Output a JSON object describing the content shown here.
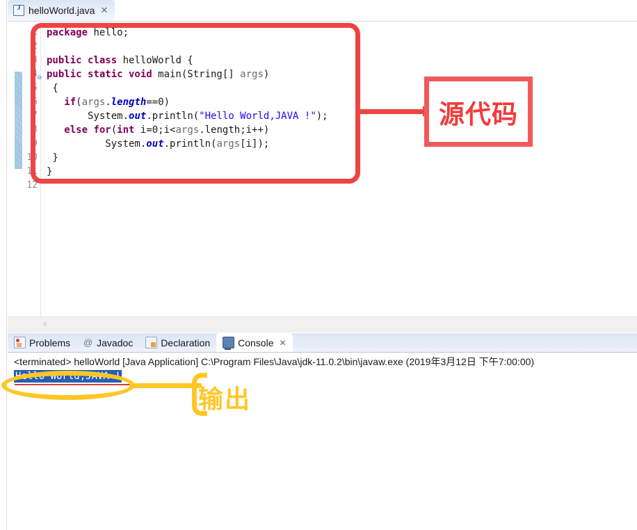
{
  "editor": {
    "tab": {
      "icon": "java-file-icon",
      "label": "helloWorld.java",
      "close": "✕"
    },
    "line_numbers": [
      "1",
      "2",
      "3",
      "4",
      "5",
      "6",
      "7",
      "8",
      "9",
      "10",
      "11",
      "12"
    ],
    "fold_marker": "⊖",
    "code_lines": [
      {
        "n": 1,
        "segments": [
          {
            "text": "package",
            "style": "kw"
          },
          {
            "text": " hello;",
            "style": "plain"
          }
        ]
      },
      {
        "n": 2,
        "segments": []
      },
      {
        "n": 3,
        "segments": [
          {
            "text": "public class",
            "style": "kw"
          },
          {
            "text": " helloWorld {",
            "style": "plain"
          }
        ]
      },
      {
        "n": 4,
        "segments": [
          {
            "text": "public static void",
            "style": "kw"
          },
          {
            "text": " main(String[] ",
            "style": "plain"
          },
          {
            "text": "args",
            "style": "param"
          },
          {
            "text": ")",
            "style": "plain"
          }
        ]
      },
      {
        "n": 5,
        "segments": [
          {
            "text": " {",
            "style": "plain"
          }
        ]
      },
      {
        "n": 6,
        "segments": [
          {
            "text": "   ",
            "style": "plain"
          },
          {
            "text": "if",
            "style": "kw"
          },
          {
            "text": "(",
            "style": "plain"
          },
          {
            "text": "args",
            "style": "param"
          },
          {
            "text": ".",
            "style": "plain"
          },
          {
            "text": "length",
            "style": "field"
          },
          {
            "text": "==0)",
            "style": "plain"
          }
        ]
      },
      {
        "n": 7,
        "segments": [
          {
            "text": "       System.",
            "style": "plain"
          },
          {
            "text": "out",
            "style": "field"
          },
          {
            "text": ".println(",
            "style": "plain"
          },
          {
            "text": "\"Hello World,JAVA !\"",
            "style": "str"
          },
          {
            "text": ");",
            "style": "plain"
          }
        ]
      },
      {
        "n": 8,
        "segments": [
          {
            "text": "   ",
            "style": "plain"
          },
          {
            "text": "else for",
            "style": "kw"
          },
          {
            "text": "(",
            "style": "plain"
          },
          {
            "text": "int",
            "style": "kw"
          },
          {
            "text": " i=0;i<",
            "style": "plain"
          },
          {
            "text": "args",
            "style": "param"
          },
          {
            "text": ".length;i++)",
            "style": "plain"
          }
        ]
      },
      {
        "n": 9,
        "segments": [
          {
            "text": "          System.",
            "style": "plain"
          },
          {
            "text": "out",
            "style": "field"
          },
          {
            "text": ".println(",
            "style": "plain"
          },
          {
            "text": "args",
            "style": "param"
          },
          {
            "text": "[i]);",
            "style": "plain"
          }
        ]
      },
      {
        "n": 10,
        "segments": [
          {
            "text": " }",
            "style": "plain"
          }
        ]
      },
      {
        "n": 11,
        "segments": [
          {
            "text": "}",
            "style": "plain"
          }
        ]
      },
      {
        "n": 12,
        "segments": []
      }
    ],
    "scrollbar": {
      "left_arrow": "‹"
    }
  },
  "bottom_view": {
    "tabs": [
      {
        "id": "problems",
        "label": "Problems",
        "icon": "problems-icon",
        "active": false,
        "closable": false
      },
      {
        "id": "javadoc",
        "label": "Javadoc",
        "icon": "javadoc-icon",
        "active": false,
        "closable": false
      },
      {
        "id": "declaration",
        "label": "Declaration",
        "icon": "declaration-icon",
        "active": false,
        "closable": false
      },
      {
        "id": "console",
        "label": "Console",
        "icon": "console-icon",
        "active": true,
        "closable": true
      }
    ],
    "close_glyph": "✕",
    "console": {
      "status_line": "<terminated> helloWorld [Java Application] C:\\Program Files\\Java\\jdk-11.0.2\\bin\\javaw.exe (2019年3月12日 下午7:00:00)",
      "output_line": "Hello World,JAVA !",
      "output_selected": true
    }
  },
  "annotations": {
    "source_code": {
      "label": "源代码",
      "color": "#f23b3b",
      "box_color": "#ef4444"
    },
    "output": {
      "label": "输出",
      "color": "#ffc726"
    }
  }
}
